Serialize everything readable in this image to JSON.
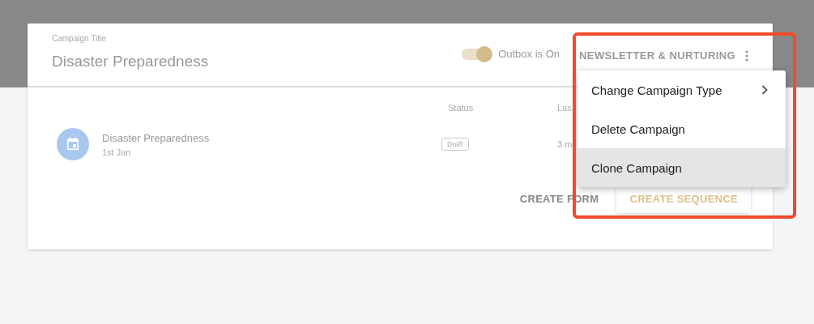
{
  "campaign": {
    "title_label": "Campaign Title",
    "title": "Disaster Preparedness",
    "outbox": {
      "label": "Outbox is On",
      "on": true
    },
    "type": "NEWSLETTER & NURTURING"
  },
  "table": {
    "columns": [
      "Status",
      "Las"
    ],
    "rows": [
      {
        "name": "Disaster Preparedness",
        "date": "1st Jan",
        "status": "Draft",
        "column_3": "3 m"
      }
    ]
  },
  "actions": [
    {
      "label": "CREATE FORM",
      "kind": "flat"
    },
    {
      "label": "CREATE SEQUENCE",
      "kind": "raised"
    }
  ],
  "menu": {
    "items": [
      {
        "label": "Change Campaign Type",
        "has_submenu": true,
        "highlighted": false
      },
      {
        "label": "Delete Campaign",
        "has_submenu": false,
        "highlighted": false
      },
      {
        "label": "Clone Campaign",
        "has_submenu": false,
        "highlighted": true
      }
    ]
  },
  "annotation": {
    "kind": "highlight-box"
  }
}
